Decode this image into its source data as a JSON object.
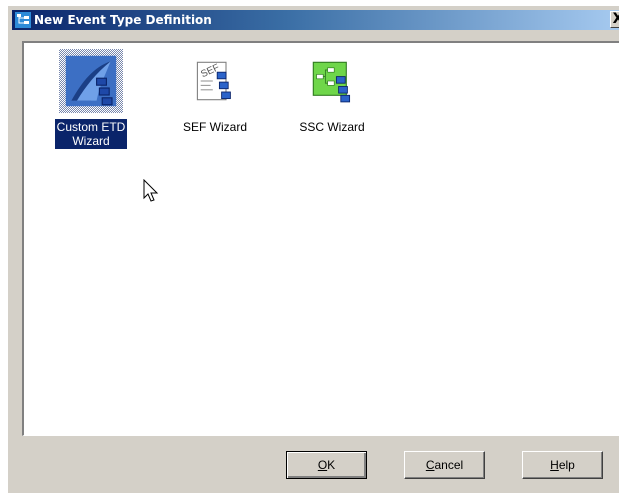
{
  "window": {
    "title": "New Event Type Definition",
    "close_glyph": "X"
  },
  "wizards": [
    {
      "label": "Custom ETD\nWizard",
      "icon": "custom-etd-wizard-icon",
      "selected": true
    },
    {
      "label": "SEF Wizard",
      "icon": "sef-wizard-icon",
      "selected": false
    },
    {
      "label": "SSC Wizard",
      "icon": "ssc-wizard-icon",
      "selected": false
    }
  ],
  "sef_icon_text": "SEF",
  "buttons": {
    "ok": {
      "mnemonic": "O",
      "rest": "K"
    },
    "cancel": {
      "mnemonic": "C",
      "rest": "ancel"
    },
    "help": {
      "mnemonic": "H",
      "rest": "elp"
    }
  },
  "colors": {
    "title_gradient_start": "#0a246a",
    "title_gradient_end": "#a6caf0",
    "dialog_face": "#d4d0c8",
    "selection": "#0a246a"
  }
}
